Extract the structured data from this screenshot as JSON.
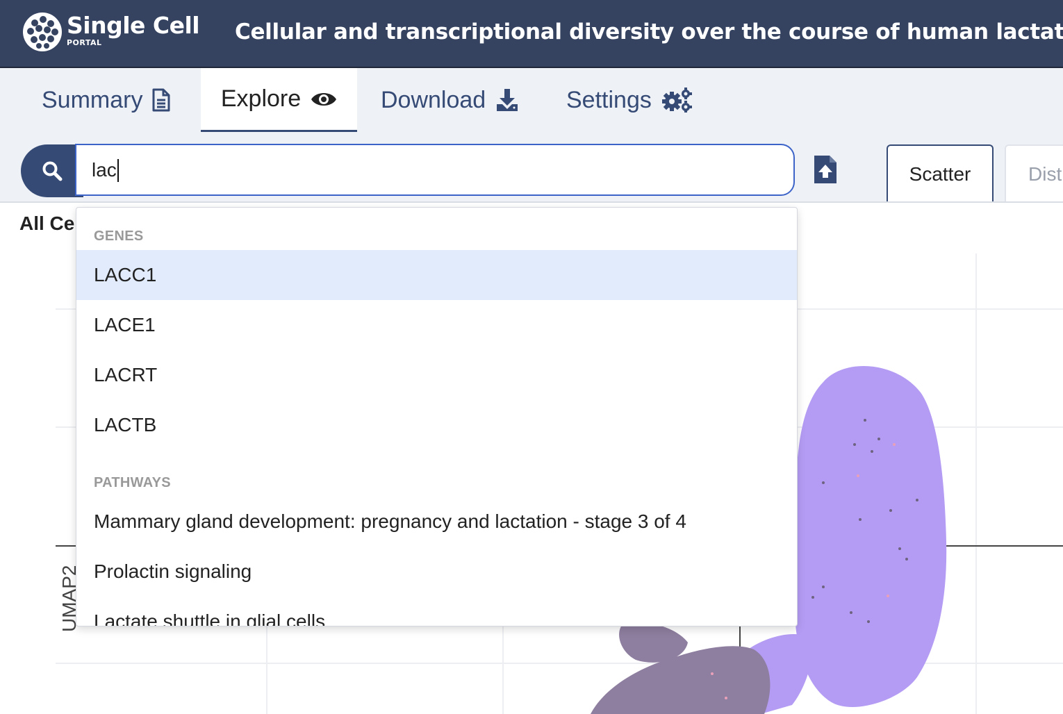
{
  "header": {
    "brand": "Single Cell",
    "brand_sub": "PORTAL",
    "study_title": "Cellular and transcriptional diversity over the course of human lactation"
  },
  "tabs": [
    {
      "label": "Summary",
      "icon": "document-icon"
    },
    {
      "label": "Explore",
      "icon": "eye-icon",
      "active": true
    },
    {
      "label": "Download",
      "icon": "download-icon"
    },
    {
      "label": "Settings",
      "icon": "gears-icon"
    }
  ],
  "search": {
    "value": "lac",
    "icon": "search-icon"
  },
  "upload": {
    "icon": "file-upload-icon"
  },
  "view_tabs": [
    {
      "label": "Scatter",
      "active": true
    },
    {
      "label": "Distr"
    }
  ],
  "plot": {
    "cluster_label": "All Cel",
    "ylabel": "UMAP2",
    "colors": {
      "cluster_a": "#b49cf4",
      "cluster_b": "#8e7e9f"
    }
  },
  "dropdown": {
    "genes_label": "GENES",
    "genes": [
      "LACC1",
      "LACE1",
      "LACRT",
      "LACTB"
    ],
    "pathways_label": "PATHWAYS",
    "pathways": [
      "Mammary gland development: pregnancy and lactation - stage 3 of 4",
      "Prolactin signaling",
      "Lactate shuttle in glial cells"
    ]
  },
  "colors": {
    "header_bg": "#354360",
    "accent": "#354a75",
    "focus": "#3c64c8",
    "highlight": "#e1ebfb"
  }
}
